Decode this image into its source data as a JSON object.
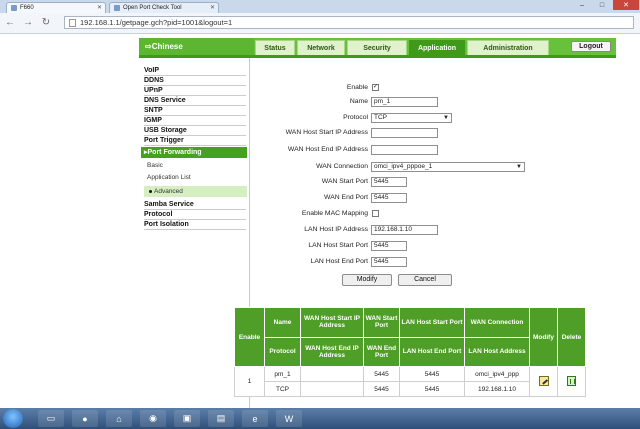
{
  "browser": {
    "tabs": [
      {
        "label": "F660",
        "active": true
      },
      {
        "label": "Open Port Check Tool",
        "active": false
      }
    ],
    "url": "192.168.1.1/getpage.gch?pid=1001&logout=1",
    "window_controls": {
      "minimize": "–",
      "maximize": "□",
      "close": "✕"
    },
    "nav": {
      "back": "←",
      "forward": "→",
      "reload": "↻"
    }
  },
  "header": {
    "language": "⇨Chinese",
    "tabs": [
      "Status",
      "Network",
      "Security",
      "Application",
      "Administration"
    ],
    "active_tab": "Application",
    "logout": "Logout"
  },
  "menu": {
    "items": [
      "VoIP",
      "DDNS",
      "UPnP",
      "DNS Service",
      "SNTP",
      "IGMP",
      "USB Storage",
      "Port Trigger"
    ],
    "active": "▸Port Forwarding",
    "subitems": [
      "Basic",
      "Application List",
      "Advanced"
    ],
    "active_sub": "Advanced",
    "items_after": [
      "Samba Service",
      "Protocol",
      "Port Isolation"
    ]
  },
  "form": {
    "enable_label": "Enable",
    "enable_checked": true,
    "check_mark": "✓",
    "name_label": "Name",
    "name_value": "pm_1",
    "protocol_label": "Protocol",
    "protocol_value": "TCP",
    "wan_start_ip_label": "WAN Host Start IP Address",
    "wan_end_ip_label": "WAN Host End IP Address",
    "wan_conn_label": "WAN Connection",
    "wan_conn_value": "omci_ipv4_pppoe_1",
    "wan_start_port_label": "WAN Start Port",
    "wan_start_port_value": "5445",
    "wan_end_port_label": "WAN End Port",
    "wan_end_port_value": "5445",
    "mac_label": "Enable MAC Mapping",
    "lan_ip_label": "LAN Host IP Address",
    "lan_ip_value": "192.168.1.10",
    "lan_start_label": "LAN Host Start Port",
    "lan_start_value": "5445",
    "lan_end_label": "LAN Host End Port",
    "lan_end_value": "5445",
    "modify": "Modify",
    "cancel": "Cancel",
    "dropdown_arrow": "▼"
  },
  "table": {
    "h_enable": "Enable",
    "h_name": "Name",
    "h_wan_start_ip": "WAN Host Start IP Address",
    "h_wan_start_port": "WAN Start Port",
    "h_lan_start_port": "LAN Host Start Port",
    "h_wan_conn": "WAN Connection",
    "h_modify": "Modify",
    "h_delete": "Delete",
    "h_protocol": "Protocol",
    "h_wan_end_ip": "WAN Host End IP Address",
    "h_wan_end_port": "WAN End Port",
    "h_lan_end_port": "LAN Host End Port",
    "h_lan_addr": "LAN Host Address",
    "row": {
      "index": "1",
      "name": "pm_1",
      "protocol": "TCP",
      "wan_start_port": "5445",
      "wan_end_port": "5445",
      "lan_start_port": "5445",
      "lan_end_port": "5445",
      "wan_conn": "omci_ipv4_ppp",
      "lan_addr": "192.168.1.10"
    }
  },
  "colors": {
    "brand_green": "#68c13a",
    "active_green": "#3f9a19"
  }
}
